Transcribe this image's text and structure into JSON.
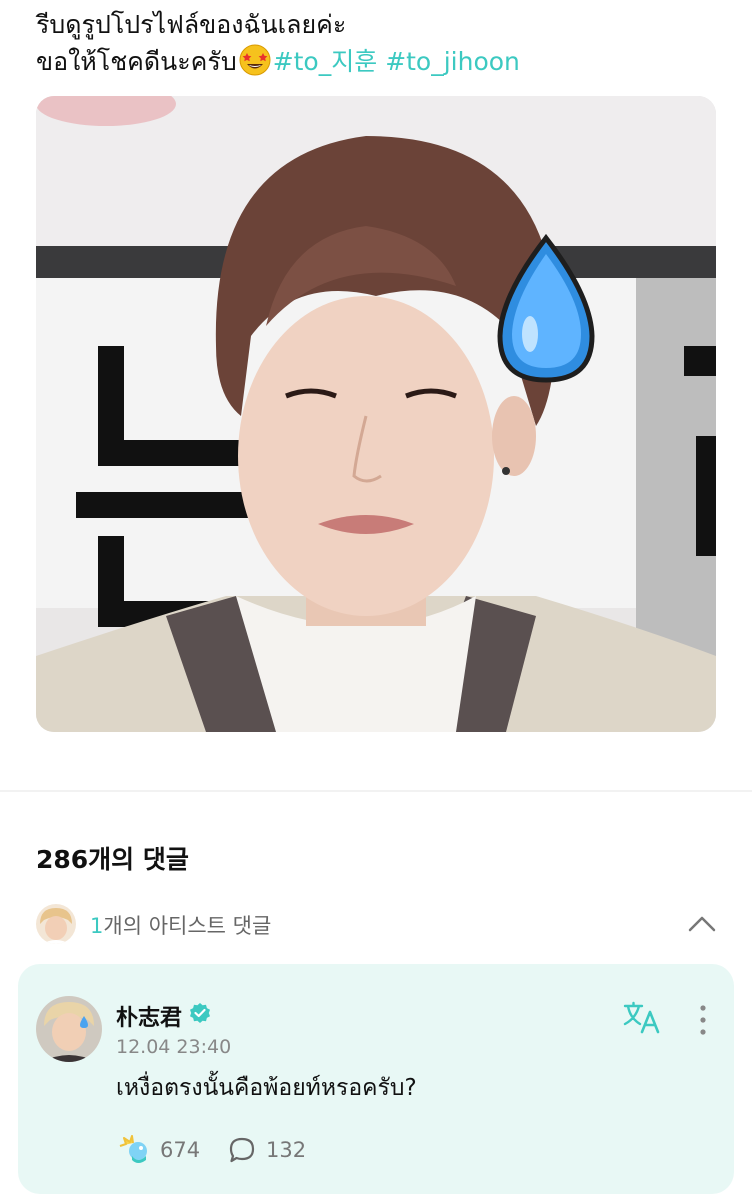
{
  "post": {
    "text_line1": "รีบดูรูปโปรไฟล์ของฉันเลยค่ะ",
    "text_line2": "ขอให้โชคดีนะครับ",
    "hashtags": [
      "#to_지훈",
      "#to_jihoon"
    ]
  },
  "comments": {
    "count_label": "286개의 댓글",
    "artist_count": "1",
    "artist_label": "개의 아티스트 댓글"
  },
  "comment": {
    "author": "朴志君",
    "time": "12.04 23:40",
    "body": "เหงื่อตรงนั้นคือพ้อยท์หรอครับ?",
    "likes": "674",
    "replies": "132"
  },
  "colors": {
    "accent": "#3cc9c1",
    "card_bg": "#e8f8f5"
  },
  "icons": [
    "star-struck-emoji-icon",
    "chevron-up-icon",
    "verified-badge-icon",
    "translate-icon",
    "more-vertical-icon",
    "like-icon",
    "reply-bubble-icon"
  ]
}
